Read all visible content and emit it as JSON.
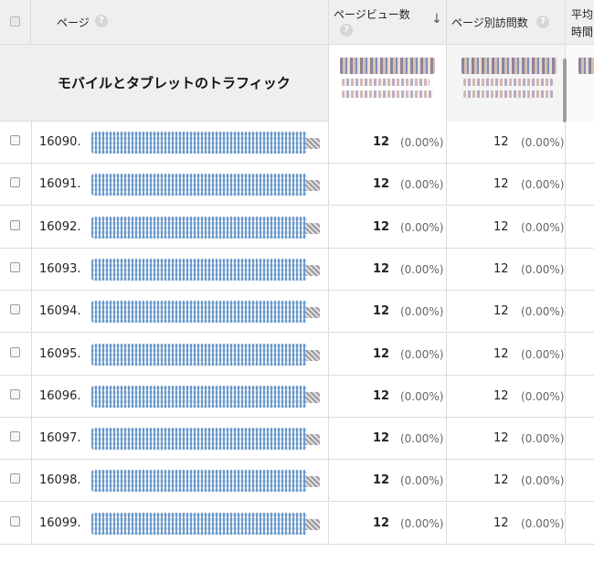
{
  "header": {
    "page_label": "ページ",
    "pageviews_label": "ページビュー数",
    "unique_pageviews_label": "ページ別訪問数",
    "avg_time_label_1": "平均",
    "avg_time_label_2": "時間",
    "help_glyph": "?",
    "sort_glyph": "↓"
  },
  "totals": {
    "segment_title": "モバイルとタブレットのトラフィック"
  },
  "rows": [
    {
      "rank": "16090.",
      "pageviews": "12",
      "pageviews_pct": "(0.00%)",
      "unique": "12",
      "unique_pct": "(0.00%)"
    },
    {
      "rank": "16091.",
      "pageviews": "12",
      "pageviews_pct": "(0.00%)",
      "unique": "12",
      "unique_pct": "(0.00%)"
    },
    {
      "rank": "16092.",
      "pageviews": "12",
      "pageviews_pct": "(0.00%)",
      "unique": "12",
      "unique_pct": "(0.00%)"
    },
    {
      "rank": "16093.",
      "pageviews": "12",
      "pageviews_pct": "(0.00%)",
      "unique": "12",
      "unique_pct": "(0.00%)"
    },
    {
      "rank": "16094.",
      "pageviews": "12",
      "pageviews_pct": "(0.00%)",
      "unique": "12",
      "unique_pct": "(0.00%)"
    },
    {
      "rank": "16095.",
      "pageviews": "12",
      "pageviews_pct": "(0.00%)",
      "unique": "12",
      "unique_pct": "(0.00%)"
    },
    {
      "rank": "16096.",
      "pageviews": "12",
      "pageviews_pct": "(0.00%)",
      "unique": "12",
      "unique_pct": "(0.00%)"
    },
    {
      "rank": "16097.",
      "pageviews": "12",
      "pageviews_pct": "(0.00%)",
      "unique": "12",
      "unique_pct": "(0.00%)"
    },
    {
      "rank": "16098.",
      "pageviews": "12",
      "pageviews_pct": "(0.00%)",
      "unique": "12",
      "unique_pct": "(0.00%)"
    },
    {
      "rank": "16099.",
      "pageviews": "12",
      "pageviews_pct": "(0.00%)",
      "unique": "12",
      "unique_pct": "(0.00%)"
    }
  ]
}
